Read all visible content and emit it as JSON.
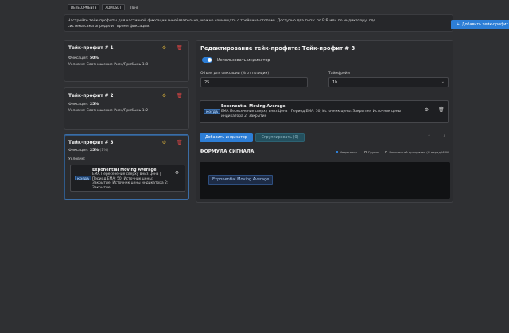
{
  "top_tabs": [
    "DEVELOPMENT3",
    "ADMUSDT",
    "Лонг"
  ],
  "info": {
    "text": "Настройте тейк-профиты для частичной фиксации (необязательно, можно совмещать с трейлинг-стопом). Доступно два типа: по R:R или по индикатору, где система сама определит время фиксации.",
    "add_button": "Добавить тейк-профит",
    "add_icon": "plus-icon"
  },
  "cards": [
    {
      "title": "Тейк-профит # 1",
      "fix_label": "Фиксация:",
      "fix_value": "50%",
      "cond_label": "Условие:",
      "cond_value": "Соотношение Риск/Прибыль 1:8"
    },
    {
      "title": "Тейк-профит # 2",
      "fix_label": "Фиксация:",
      "fix_value": "25%",
      "cond_label": "Условие:",
      "cond_value": "Соотношение Риск/Прибыль 1:2"
    },
    {
      "title": "Тейк-профит # 3",
      "fix_label": "Фиксация:",
      "fix_value": "25%",
      "fix_extra": "(1%)",
      "cond_label": "Условие:",
      "indicator": {
        "badge": "КОГДА",
        "title": "Exponential Moving Average",
        "desc": "EMA Пересечение сверху вниз Цена | Период EMA: 50, Источник цены: Закрытие, Источник цены индикатора 2: Закрытие"
      }
    }
  ],
  "editor": {
    "title": "Редактирование тейк-профита: Тейк-профит # 3",
    "use_indicator": "Использовать индикатор",
    "volume_label": "Объем для фиксации (% от позиции)",
    "volume_value": "25",
    "timeframe_label": "Таймфрейм",
    "timeframe_value": "1h",
    "indicator": {
      "badge": "КОГДА",
      "title": "Exponential Moving Average",
      "desc": "EMA Пересечение сверху вниз Цена | Период EMA: 50, Источник цены: Закрытие, Источник цены индикатора 2: Закрытие"
    },
    "add_indicator": "Добавить индикатор",
    "group_button": "Сгруппировать (0)",
    "formula_title": "ФОРМУЛА СИГНАЛА",
    "legend": [
      "Индикатор",
      "Группа",
      "Логический приоритет (И перед ИЛИ)"
    ],
    "formula_chip": "Exponential Moving Average"
  },
  "colors": {
    "accent": "#2d7ed6",
    "danger": "#e04545",
    "warning": "#c8a33a",
    "background": "#2f3033"
  }
}
